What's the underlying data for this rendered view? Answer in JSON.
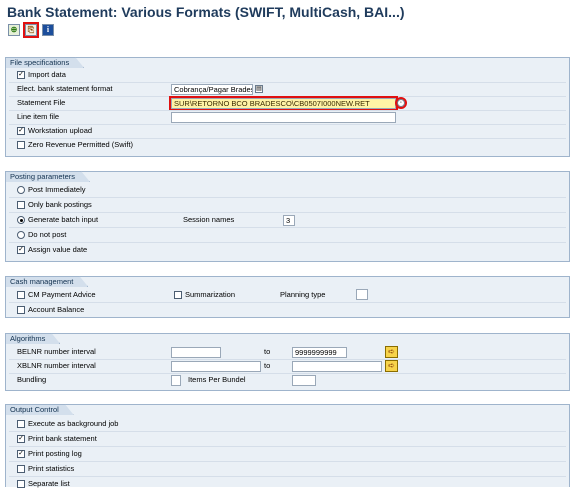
{
  "title": "Bank Statement: Various Formats (SWIFT, MultiCash, BAI...)",
  "toolbar": [
    {
      "name": "execute-icon",
      "glyph": "⊕"
    },
    {
      "name": "variant-icon",
      "glyph": "⎘"
    },
    {
      "name": "info-icon",
      "glyph": "i"
    }
  ],
  "file_spec": {
    "header": "File specifications",
    "import_data": "Import data",
    "bank_format_label": "Elect. bank statement format",
    "bank_format_value": "Cobrança/Pagar Bradesco - Brazil",
    "statement_file_label": "Statement File",
    "statement_file_value": "SUR\\RETORNO BCO BRADESCO\\CB0507I000NEW.RET",
    "line_item_label": "Line item file",
    "workstation_upload": "Workstation upload",
    "zero_revenue": "Zero Revenue Permitted (Swift)"
  },
  "posting": {
    "header": "Posting parameters",
    "post_immediately": "Post Immediately",
    "only_bank": "Only bank postings",
    "generate_batch": "Generate batch input",
    "session_names_label": "Session names",
    "session_names_value": "3",
    "do_not_post": "Do not post",
    "assign_value_date": "Assign value date"
  },
  "cash": {
    "header": "Cash management",
    "cm_payment": "CM Payment Advice",
    "summarization": "Summarization",
    "planning_type": "Planning type",
    "account_balance": "Account Balance"
  },
  "algorithms": {
    "header": "Algorithms",
    "belnr": "BELNR number interval",
    "to": "to",
    "belnr_to_value": "9999999999",
    "xblnr": "XBLNR number interval",
    "bundling": "Bundling",
    "items_per_bundel": "Items Per Bundel"
  },
  "output": {
    "header": "Output Control",
    "background_job": "Execute as background job",
    "print_bank_statement": "Print bank statement",
    "print_posting_log": "Print posting log",
    "print_statistics": "Print statistics",
    "separate_list": "Separate list"
  },
  "colors": {
    "title": "#1f3b5c",
    "group_bg": "#eaf0f6",
    "highlight": "#e01010",
    "file_field": "#fff3a6"
  }
}
